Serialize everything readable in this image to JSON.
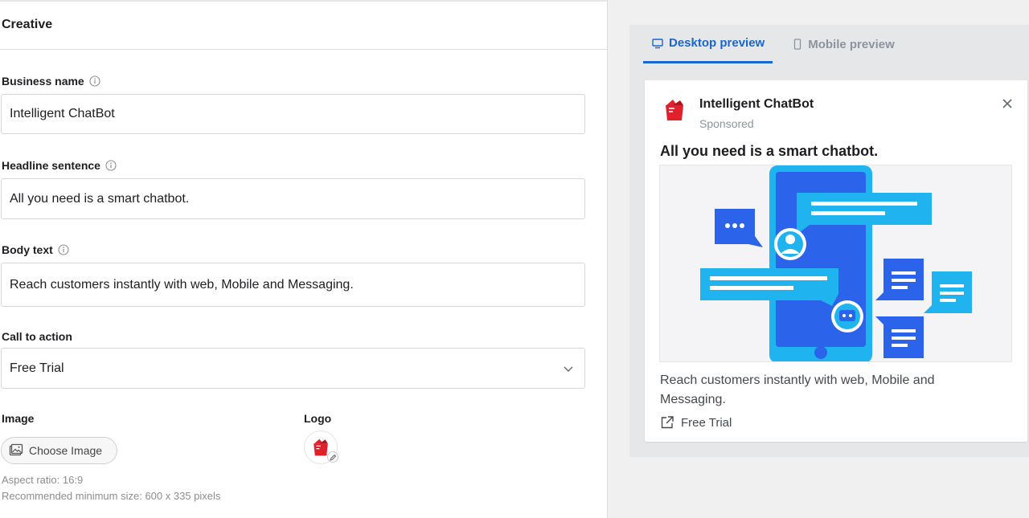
{
  "form": {
    "section_title": "Creative",
    "business_name": {
      "label": "Business name",
      "value": "Intelligent ChatBot"
    },
    "headline": {
      "label": "Headline sentence",
      "value": "All you need is a smart chatbot."
    },
    "body": {
      "label": "Body text",
      "value": "Reach customers instantly with web, Mobile and Messaging."
    },
    "cta": {
      "label": "Call to action",
      "value": "Free Trial"
    },
    "image": {
      "label": "Image",
      "button_label": "Choose Image",
      "hint_ratio": "Aspect ratio: 16:9",
      "hint_size": "Recommended minimum size: 600 x 335 pixels"
    },
    "logo": {
      "label": "Logo"
    }
  },
  "preview": {
    "tabs": [
      {
        "label": "Desktop preview",
        "icon": "desktop-icon",
        "active": true
      },
      {
        "label": "Mobile preview",
        "icon": "mobile-icon",
        "active": false
      }
    ],
    "ad": {
      "business_name": "Intelligent ChatBot",
      "sponsored": "Sponsored",
      "headline": "All you need is a smart chatbot.",
      "body": "Reach customers instantly with web, Mobile and Messaging.",
      "cta": "Free Trial"
    }
  },
  "colors": {
    "accent": "#1a66d0",
    "brand_red": "#e0202b",
    "phone_blue": "#2b63ea",
    "bubble_cyan": "#1fb4f0"
  }
}
